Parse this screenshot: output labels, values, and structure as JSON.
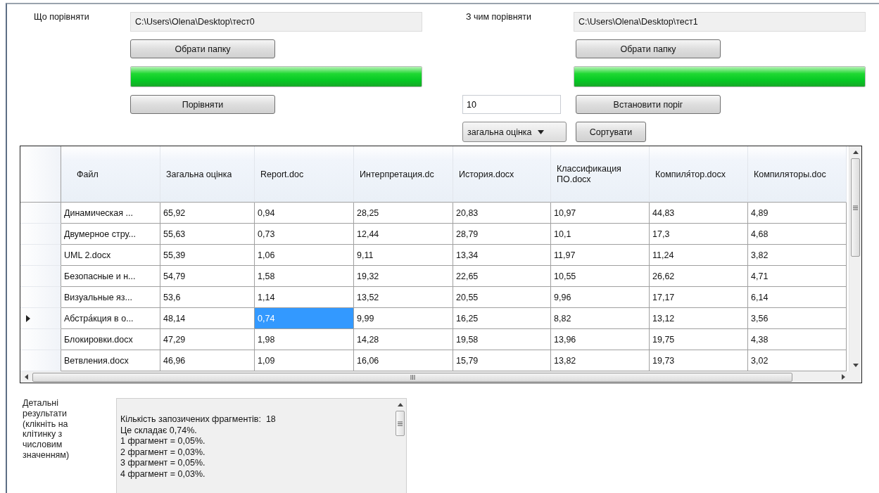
{
  "source": {
    "label": "Що порівняти",
    "path": "C:\\Users\\Olena\\Desktop\\тест0",
    "choose_button": "Обрати папку",
    "progress": {
      "level": 1
    },
    "compare_button": "Порівняти"
  },
  "target": {
    "label": "З чим порівняти",
    "path": "C:\\Users\\Olena\\Desktop\\тест1",
    "choose_button": "Обрати папку",
    "progress": {
      "level": 1
    }
  },
  "threshold": {
    "value": "10",
    "button": "Встановити поріг"
  },
  "sort": {
    "selected_option": "загальна оцінка",
    "button": "Сортувати"
  },
  "table": {
    "columns": [
      "Файл",
      "Загальна оцінка",
      "Report.doc",
      "Интерпретация.dc",
      "История.docx",
      "Классификация ПО.docx",
      "Компиля́тор.docx",
      "Компиляторы.doc"
    ],
    "rows": [
      {
        "current": false,
        "cells": [
          {
            "text": "Динамическая ...",
            "selected": false
          },
          {
            "text": "65,92",
            "selected": false
          },
          {
            "text": "0,94",
            "selected": false
          },
          {
            "text": "28,25",
            "selected": false
          },
          {
            "text": "20,83",
            "selected": false
          },
          {
            "text": "10,97",
            "selected": false
          },
          {
            "text": "44,83",
            "selected": false
          },
          {
            "text": "4,89",
            "selected": false
          }
        ]
      },
      {
        "current": false,
        "cells": [
          {
            "text": "Двумерное стру...",
            "selected": false
          },
          {
            "text": "55,63",
            "selected": false
          },
          {
            "text": "0,73",
            "selected": false
          },
          {
            "text": "12,44",
            "selected": false
          },
          {
            "text": "28,79",
            "selected": false
          },
          {
            "text": "10,1",
            "selected": false
          },
          {
            "text": "17,3",
            "selected": false
          },
          {
            "text": "4,68",
            "selected": false
          }
        ]
      },
      {
        "current": false,
        "cells": [
          {
            "text": "UML 2.docx",
            "selected": false
          },
          {
            "text": "55,39",
            "selected": false
          },
          {
            "text": "1,06",
            "selected": false
          },
          {
            "text": "9,11",
            "selected": false
          },
          {
            "text": "13,34",
            "selected": false
          },
          {
            "text": "11,97",
            "selected": false
          },
          {
            "text": "11,24",
            "selected": false
          },
          {
            "text": "3,82",
            "selected": false
          }
        ]
      },
      {
        "current": false,
        "cells": [
          {
            "text": "Безопасные и н...",
            "selected": false
          },
          {
            "text": "54,79",
            "selected": false
          },
          {
            "text": "1,58",
            "selected": false
          },
          {
            "text": "19,32",
            "selected": false
          },
          {
            "text": "22,65",
            "selected": false
          },
          {
            "text": "10,55",
            "selected": false
          },
          {
            "text": "26,62",
            "selected": false
          },
          {
            "text": "4,71",
            "selected": false
          }
        ]
      },
      {
        "current": false,
        "cells": [
          {
            "text": "Визуальные яз...",
            "selected": false
          },
          {
            "text": "53,6",
            "selected": false
          },
          {
            "text": "1,14",
            "selected": false
          },
          {
            "text": "13,52",
            "selected": false
          },
          {
            "text": "20,55",
            "selected": false
          },
          {
            "text": "9,96",
            "selected": false
          },
          {
            "text": "17,17",
            "selected": false
          },
          {
            "text": "6,14",
            "selected": false
          }
        ]
      },
      {
        "current": true,
        "cells": [
          {
            "text": "Абстра́кция в о...",
            "selected": false
          },
          {
            "text": "48,14",
            "selected": false
          },
          {
            "text": "0,74",
            "selected": true
          },
          {
            "text": "9,99",
            "selected": false
          },
          {
            "text": "16,25",
            "selected": false
          },
          {
            "text": "8,82",
            "selected": false
          },
          {
            "text": "13,12",
            "selected": false
          },
          {
            "text": "3,56",
            "selected": false
          }
        ]
      },
      {
        "current": false,
        "cells": [
          {
            "text": "Блокировки.docx",
            "selected": false
          },
          {
            "text": "47,29",
            "selected": false
          },
          {
            "text": "1,98",
            "selected": false
          },
          {
            "text": "14,28",
            "selected": false
          },
          {
            "text": "19,58",
            "selected": false
          },
          {
            "text": "13,96",
            "selected": false
          },
          {
            "text": "19,75",
            "selected": false
          },
          {
            "text": "4,38",
            "selected": false
          }
        ]
      },
      {
        "current": false,
        "cells": [
          {
            "text": "Ветвления.docx",
            "selected": false
          },
          {
            "text": "46,96",
            "selected": false
          },
          {
            "text": "1,09",
            "selected": false
          },
          {
            "text": "16,06",
            "selected": false
          },
          {
            "text": "15,79",
            "selected": false
          },
          {
            "text": "13,82",
            "selected": false
          },
          {
            "text": "19,73",
            "selected": false
          },
          {
            "text": "3,02",
            "selected": false
          }
        ]
      }
    ]
  },
  "details": {
    "label": "Детальні результати (клікніть на клітинку з числовим значенням)",
    "lines": [
      "Кількість запозичених фрагментів:  18",
      "Це складає 0,74%.",
      "1 фрагмент = 0,05%.",
      "2 фрагмент = 0,03%.",
      "3 фрагмент = 0,05%.",
      "4 фрагмент = 0,03%."
    ]
  }
}
